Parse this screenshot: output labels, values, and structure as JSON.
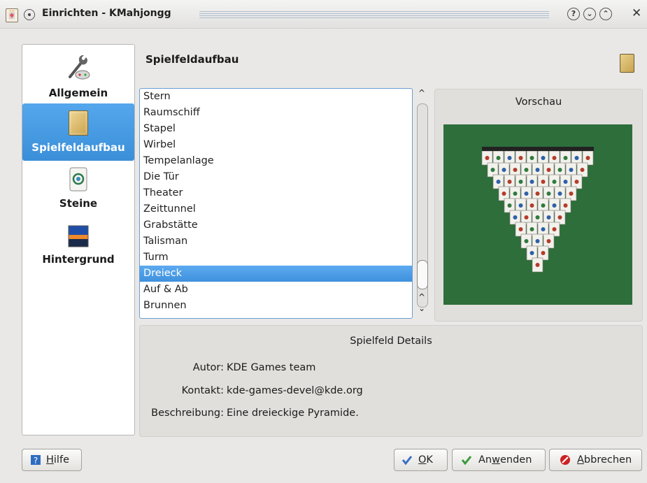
{
  "window": {
    "title": "Einrichten - KMahjongg",
    "app_icon_glyph": "🀄",
    "help_glyph": "?",
    "shade_glyph": "⌄",
    "max_glyph": "⌃",
    "close_glyph": "✕"
  },
  "nav": {
    "items": [
      {
        "label": "Allgemein",
        "icon": "tools-gamepad-icon"
      },
      {
        "label": "Spielfeldaufbau",
        "icon": "tile-layout-icon",
        "selected": true
      },
      {
        "label": "Steine",
        "icon": "mahjong-tile-icon"
      },
      {
        "label": "Hintergrund",
        "icon": "sunset-image-icon"
      }
    ]
  },
  "header": {
    "title": "Spielfeldaufbau"
  },
  "layouts": {
    "items": [
      "Stern",
      "Raumschiff",
      "Stapel",
      "Wirbel",
      "Tempelanlage",
      "Die Tür",
      "Theater",
      "Zeittunnel",
      "Grabstätte",
      "Talisman",
      "Turm",
      "Dreieck",
      "Auf & Ab",
      "Brunnen"
    ],
    "selected": "Dreieck"
  },
  "scroll": {
    "up": "^",
    "down_up": "^",
    "down": "⌄"
  },
  "preview": {
    "title": "Vorschau"
  },
  "details": {
    "title": "Spielfeld Details",
    "author_label": "Autor:",
    "author": "KDE Games team",
    "contact_label": "Kontakt:",
    "contact": "kde-games-devel@kde.org",
    "desc_label": "Beschreibung:",
    "description": "Eine dreieckige Pyramide."
  },
  "buttons": {
    "help_pre": "",
    "help_u": "H",
    "help_post": "ilfe",
    "ok_pre": "",
    "ok_u": "O",
    "ok_post": "K",
    "apply_pre": "An",
    "apply_u": "w",
    "apply_post": "enden",
    "cancel_pre": "",
    "cancel_u": "A",
    "cancel_post": "bbrechen"
  },
  "colors": {
    "accent": "#3f91dc",
    "felt": "#2d6e3a"
  }
}
